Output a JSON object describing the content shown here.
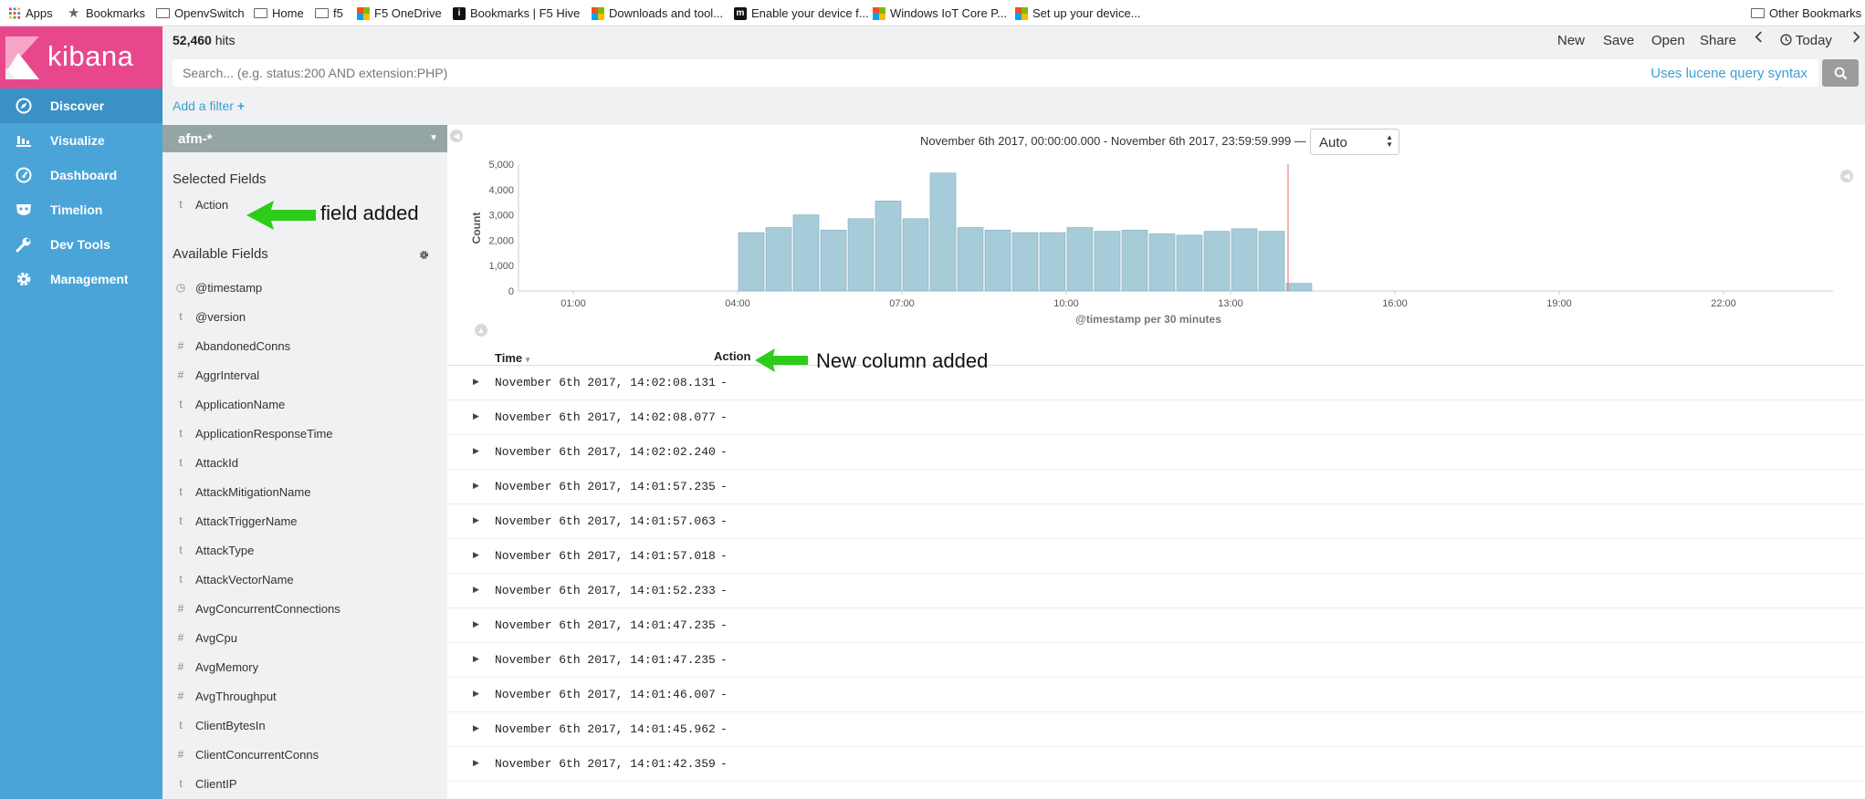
{
  "bookmarks_bar": {
    "items": [
      {
        "label": "Apps",
        "icon": "apps-grid-icon"
      },
      {
        "label": "Bookmarks",
        "icon": "star-icon"
      },
      {
        "label": "OpenvSwitch",
        "icon": "folder-icon"
      },
      {
        "label": "Home",
        "icon": "folder-icon"
      },
      {
        "label": "f5",
        "icon": "folder-icon"
      },
      {
        "label": "F5 OneDrive",
        "icon": "microsoft-icon"
      },
      {
        "label": "Bookmarks | F5 Hive",
        "icon": "hive-icon"
      },
      {
        "label": "Downloads and tool...",
        "icon": "microsoft-icon"
      },
      {
        "label": "Enable your device f...",
        "icon": "m-logo-icon"
      },
      {
        "label": "Windows IoT Core P...",
        "icon": "microsoft-icon"
      },
      {
        "label": "Set up your device...",
        "icon": "microsoft-icon"
      }
    ],
    "other": "Other Bookmarks",
    "hive_glyph": "i",
    "m_glyph": "m"
  },
  "app": {
    "logo_text": "kibana"
  },
  "nav": {
    "items": [
      {
        "label": "Discover",
        "icon": "compass-icon",
        "active": true
      },
      {
        "label": "Visualize",
        "icon": "bar-chart-icon",
        "active": false
      },
      {
        "label": "Dashboard",
        "icon": "dashboard-gauge-icon",
        "active": false
      },
      {
        "label": "Timelion",
        "icon": "timelion-mask-icon",
        "active": false
      },
      {
        "label": "Dev Tools",
        "icon": "wrench-icon",
        "active": false
      },
      {
        "label": "Management",
        "icon": "gear-icon",
        "active": false
      }
    ]
  },
  "toolbar": {
    "hits_count": "52,460",
    "hits_label": "hits",
    "new": "New",
    "save": "Save",
    "open": "Open",
    "share": "Share",
    "today": "Today"
  },
  "search": {
    "placeholder": "Search... (e.g. status:200 AND extension:PHP)",
    "syntax_link": "Uses lucene query syntax"
  },
  "filter": {
    "add_label": "Add a filter",
    "plus": "+"
  },
  "sidebar": {
    "index_pattern": "afm-*",
    "selected_heading": "Selected Fields",
    "selected_fields": [
      {
        "type": "t",
        "name": "Action"
      }
    ],
    "available_heading": "Available Fields",
    "available_fields": [
      {
        "type": "clock",
        "name": "@timestamp"
      },
      {
        "type": "t",
        "name": "@version"
      },
      {
        "type": "#",
        "name": "AbandonedConns"
      },
      {
        "type": "#",
        "name": "AggrInterval"
      },
      {
        "type": "t",
        "name": "ApplicationName"
      },
      {
        "type": "t",
        "name": "ApplicationResponseTime"
      },
      {
        "type": "t",
        "name": "AttackId"
      },
      {
        "type": "t",
        "name": "AttackMitigationName"
      },
      {
        "type": "t",
        "name": "AttackTriggerName"
      },
      {
        "type": "t",
        "name": "AttackType"
      },
      {
        "type": "t",
        "name": "AttackVectorName"
      },
      {
        "type": "#",
        "name": "AvgConcurrentConnections"
      },
      {
        "type": "#",
        "name": "AvgCpu"
      },
      {
        "type": "#",
        "name": "AvgMemory"
      },
      {
        "type": "#",
        "name": "AvgThroughput"
      },
      {
        "type": "t",
        "name": "ClientBytesIn"
      },
      {
        "type": "#",
        "name": "ClientConcurrentConns"
      },
      {
        "type": "t",
        "name": "ClientIP"
      }
    ]
  },
  "histogram": {
    "range_text": "November 6th 2017, 00:00:00.000 - November 6th 2017, 23:59:59.999 —",
    "interval": "Auto",
    "chart_data": {
      "type": "bar",
      "ylabel": "Count",
      "xlabel": "@timestamp per 30 minutes",
      "ylim": [
        0,
        5000
      ],
      "y_ticks": [
        "5,000",
        "4,000",
        "3,000",
        "2,000",
        "1,000",
        "0"
      ],
      "x_ticks": [
        "01:00",
        "04:00",
        "07:00",
        "10:00",
        "13:00",
        "16:00",
        "19:00",
        "22:00"
      ],
      "x_start_hour": 0,
      "x_end_hour": 24,
      "bar_color": "#a6ccda",
      "now_marker_hour": 14.05,
      "bars": [
        {
          "hour": 4.0,
          "value": 2300
        },
        {
          "hour": 4.5,
          "value": 2500
        },
        {
          "hour": 5.0,
          "value": 3000
        },
        {
          "hour": 5.5,
          "value": 2400
        },
        {
          "hour": 6.0,
          "value": 2850
        },
        {
          "hour": 6.5,
          "value": 3550
        },
        {
          "hour": 7.0,
          "value": 2850
        },
        {
          "hour": 7.5,
          "value": 4650
        },
        {
          "hour": 8.0,
          "value": 2500
        },
        {
          "hour": 8.5,
          "value": 2400
        },
        {
          "hour": 9.0,
          "value": 2300
        },
        {
          "hour": 9.5,
          "value": 2300
        },
        {
          "hour": 10.0,
          "value": 2500
        },
        {
          "hour": 10.5,
          "value": 2350
        },
        {
          "hour": 11.0,
          "value": 2400
        },
        {
          "hour": 11.5,
          "value": 2250
        },
        {
          "hour": 12.0,
          "value": 2200
        },
        {
          "hour": 12.5,
          "value": 2350
        },
        {
          "hour": 13.0,
          "value": 2450
        },
        {
          "hour": 13.5,
          "value": 2350
        },
        {
          "hour": 14.0,
          "value": 300
        }
      ]
    }
  },
  "table": {
    "columns": [
      "Time",
      "Action"
    ],
    "sort_glyph": "▾",
    "expand_glyph": "▶",
    "rows": [
      {
        "time": "November 6th 2017, 14:02:08.131",
        "action": "-"
      },
      {
        "time": "November 6th 2017, 14:02:08.077",
        "action": "-"
      },
      {
        "time": "November 6th 2017, 14:02:02.240",
        "action": "-"
      },
      {
        "time": "November 6th 2017, 14:01:57.235",
        "action": "-"
      },
      {
        "time": "November 6th 2017, 14:01:57.063",
        "action": "-"
      },
      {
        "time": "November 6th 2017, 14:01:57.018",
        "action": "-"
      },
      {
        "time": "November 6th 2017, 14:01:52.233",
        "action": "-"
      },
      {
        "time": "November 6th 2017, 14:01:47.235",
        "action": "-"
      },
      {
        "time": "November 6th 2017, 14:01:47.235",
        "action": "-"
      },
      {
        "time": "November 6th 2017, 14:01:46.007",
        "action": "-"
      },
      {
        "time": "November 6th 2017, 14:01:45.962",
        "action": "-"
      },
      {
        "time": "November 6th 2017, 14:01:42.359",
        "action": "-"
      }
    ]
  },
  "annotations": {
    "field_added": "field added",
    "column_added": "New column added",
    "arrow_color": "#2ecc1a"
  }
}
